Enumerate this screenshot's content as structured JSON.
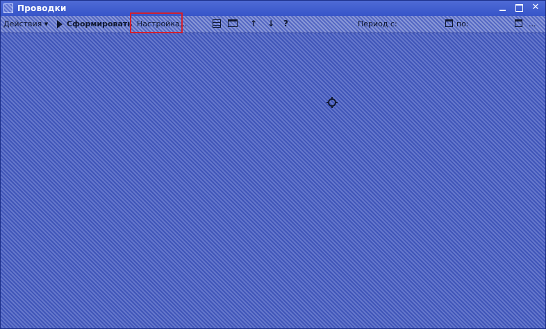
{
  "window": {
    "title": "Проводки"
  },
  "toolbar": {
    "actions_label": "Действия ▾",
    "generate_label": "Сформировать",
    "settings_label": "Настройка...",
    "up_icon": "↑",
    "down_icon": "↓",
    "help_icon": "?",
    "period_label": "Период с:",
    "to_label": "по:",
    "ellipsis": "..."
  },
  "colors": {
    "titlebar": "#3655c9",
    "highlight": "#d02030"
  }
}
